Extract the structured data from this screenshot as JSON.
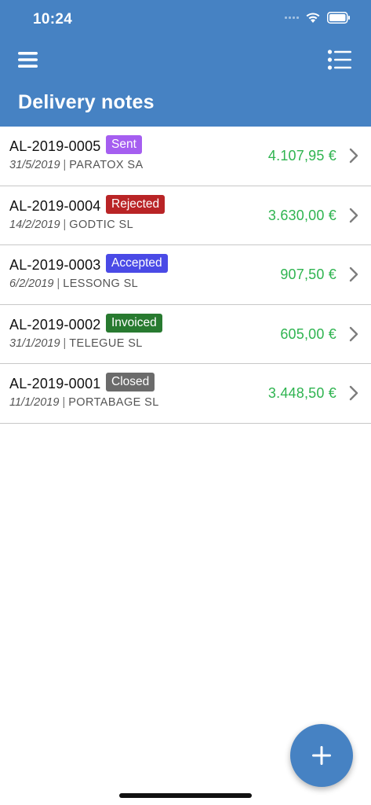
{
  "status_bar": {
    "time": "10:24",
    "icons": [
      "cellular-signal-icon",
      "wifi-icon",
      "battery-icon"
    ]
  },
  "header": {
    "title": "Delivery notes",
    "menu_icon": "hamburger-menu-icon",
    "list_icon": "list-options-icon",
    "background_color": "#4682c3"
  },
  "delivery_notes": [
    {
      "code": "AL-2019-0005",
      "status": "Sent",
      "status_color": "#a55ef0",
      "date": "31/5/2019",
      "client": "PARATOX SA",
      "amount": "4.107,95 €"
    },
    {
      "code": "AL-2019-0004",
      "status": "Rejected",
      "status_color": "#b92426",
      "date": "14/2/2019",
      "client": "GODTIC SL",
      "amount": "3.630,00 €"
    },
    {
      "code": "AL-2019-0003",
      "status": "Accepted",
      "status_color": "#4a4ae6",
      "date": "6/2/2019",
      "client": "LESSONG SL",
      "amount": "907,50 €"
    },
    {
      "code": "AL-2019-0002",
      "status": "Invoiced",
      "status_color": "#287a30",
      "date": "31/1/2019",
      "client": "TELEGUE SL",
      "amount": "605,00 €"
    },
    {
      "code": "AL-2019-0001",
      "status": "Closed",
      "status_color": "#6b6b6b",
      "date": "11/1/2019",
      "client": "PORTABAGE SL",
      "amount": "3.448,50 €"
    }
  ],
  "amount_color": "#2fb450",
  "fab": {
    "icon": "plus-icon",
    "color": "#4682c3"
  }
}
